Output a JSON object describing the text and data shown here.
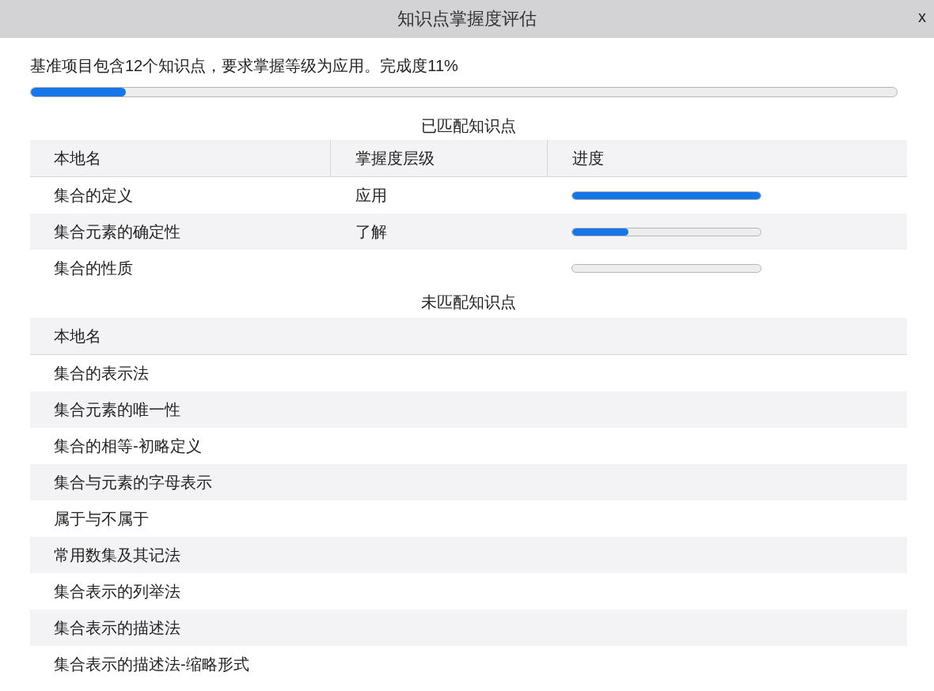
{
  "window": {
    "title": "知识点掌握度评估",
    "close": "x"
  },
  "summary": {
    "text": "基准项目包含12个知识点，要求掌握等级为应用。完成度11%",
    "level": 0.11
  },
  "matched": {
    "title": "已匹配知识点",
    "columns": [
      "本地名",
      "掌握度层级",
      "进度"
    ],
    "rows": [
      {
        "name": "集合的定义",
        "mastery": "应用",
        "level": 1.0
      },
      {
        "name": "集合元素的确定性",
        "mastery": "了解",
        "level": 0.3
      },
      {
        "name": "集合的性质",
        "level": 0
      }
    ]
  },
  "unmatched": {
    "title": "未匹配知识点",
    "columns": [
      "本地名"
    ],
    "rows": [
      "集合的表示法",
      "集合元素的唯一性",
      "集合的相等-初略定义",
      "集合与元素的字母表示",
      "属于与不属于",
      "常用数集及其记法",
      "集合表示的列举法",
      "集合表示的描述法",
      "集合表示的描述法-缩略形式"
    ]
  }
}
